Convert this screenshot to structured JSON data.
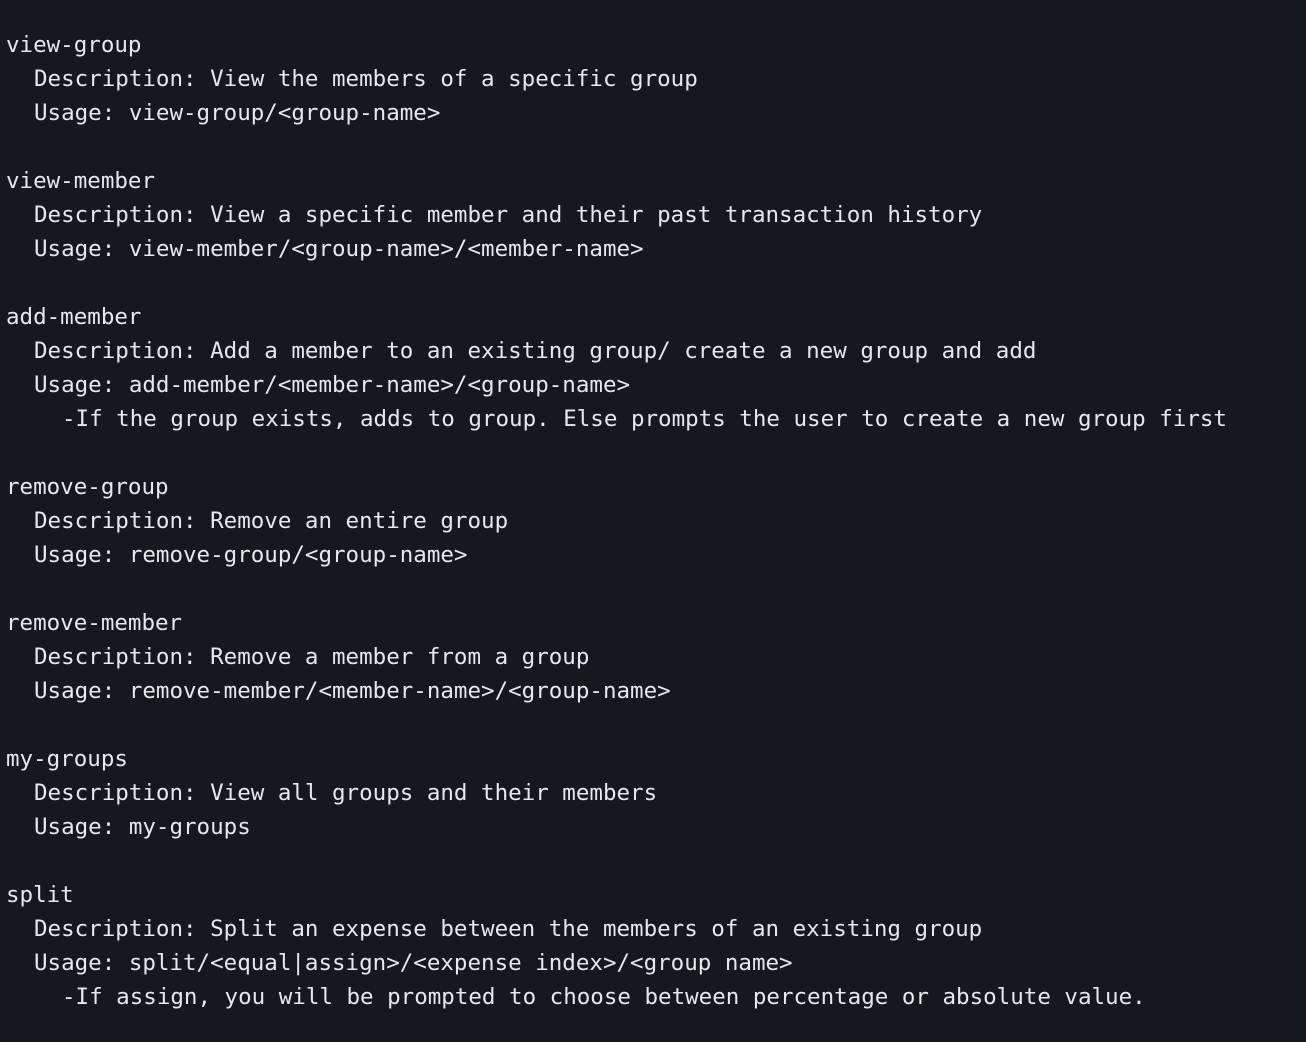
{
  "commands": [
    {
      "name": "view-group",
      "description": "Description: View the members of a specific group",
      "usage": "Usage: view-group/<group-name>",
      "note": ""
    },
    {
      "name": "view-member",
      "description": "Description: View a specific member and their past transaction history",
      "usage": "Usage: view-member/<group-name>/<member-name>",
      "note": ""
    },
    {
      "name": "add-member",
      "description": "Description: Add a member to an existing group/ create a new group and add",
      "usage": "Usage: add-member/<member-name>/<group-name>",
      "note": "-If the group exists, adds to group. Else prompts the user to create a new group first"
    },
    {
      "name": "remove-group",
      "description": "Description: Remove an entire group",
      "usage": "Usage: remove-group/<group-name>",
      "note": ""
    },
    {
      "name": "remove-member",
      "description": "Description: Remove a member from a group",
      "usage": "Usage: remove-member/<member-name>/<group-name>",
      "note": ""
    },
    {
      "name": "my-groups",
      "description": "Description: View all groups and their members",
      "usage": "Usage: my-groups",
      "note": ""
    },
    {
      "name": "split",
      "description": "Description: Split an expense between the members of an existing group",
      "usage": "Usage: split/<equal|assign>/<expense index>/<group name>",
      "note": "-If assign, you will be prompted to choose between percentage or absolute value."
    }
  ],
  "colors": {
    "background": "#16181d",
    "text": "#e7e8ea"
  }
}
